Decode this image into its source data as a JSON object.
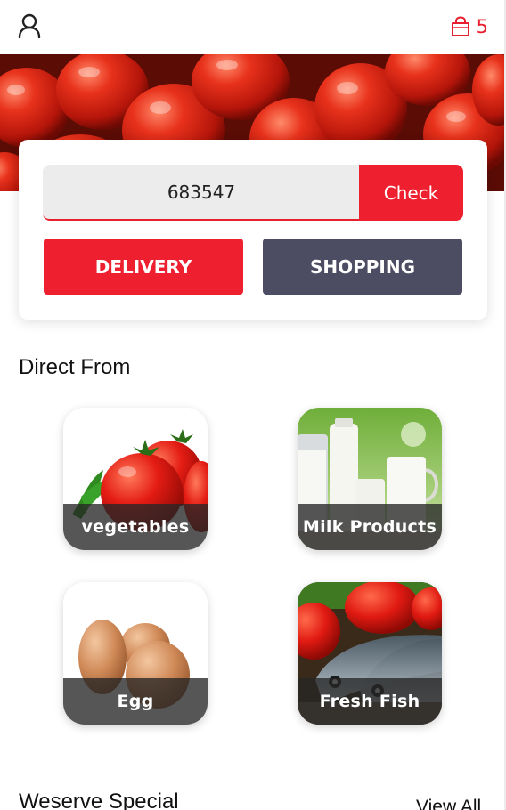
{
  "header": {
    "user_icon": "user-icon",
    "cart_icon": "shopping-bag-icon",
    "cart_count": "5"
  },
  "colors": {
    "accent": "#ee1f2e",
    "secondary": "#4c4c62"
  },
  "pincode": {
    "value": "683547",
    "check_label": "Check"
  },
  "modes": {
    "delivery_label": "DELIVERY",
    "shopping_label": "SHOPPING"
  },
  "direct_from": {
    "title": "Direct From",
    "categories": [
      {
        "label": "vegetables"
      },
      {
        "label": "Milk Products"
      },
      {
        "label": "Egg"
      },
      {
        "label": "Fresh Fish"
      }
    ]
  },
  "special": {
    "title": "Weserve Special",
    "view_all_label": "View All"
  }
}
